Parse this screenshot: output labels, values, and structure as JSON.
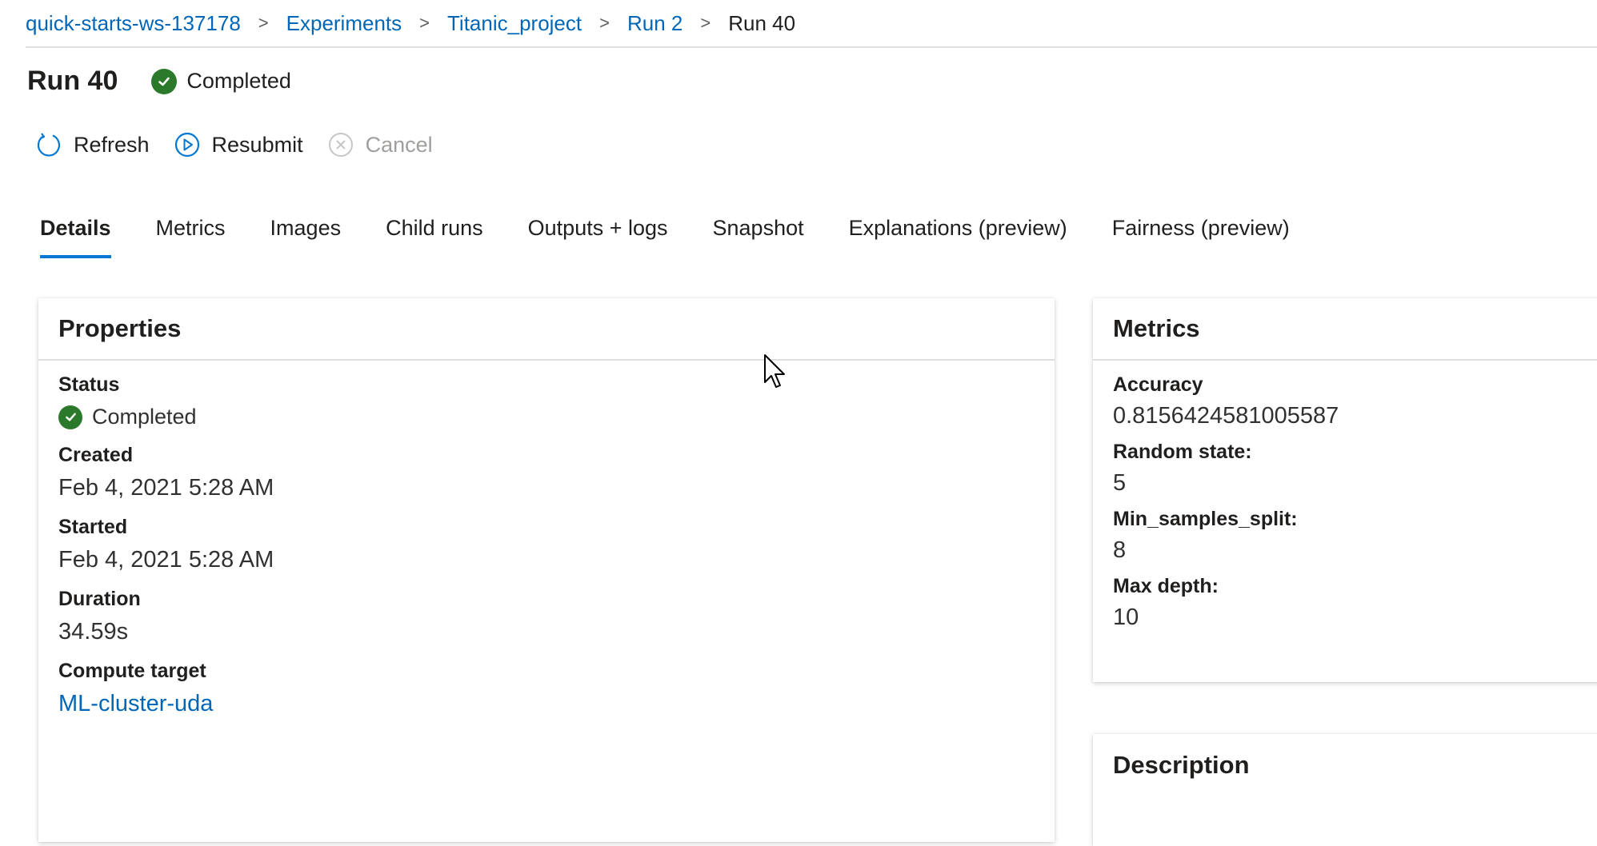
{
  "breadcrumb": {
    "items": [
      "quick-starts-ws-137178",
      "Experiments",
      "Titanic_project",
      "Run 2"
    ],
    "current": "Run 40",
    "separator": ">"
  },
  "header": {
    "title": "Run 40",
    "status": "Completed"
  },
  "toolbar": {
    "refresh": "Refresh",
    "resubmit": "Resubmit",
    "cancel": "Cancel"
  },
  "tabs": [
    "Details",
    "Metrics",
    "Images",
    "Child runs",
    "Outputs + logs",
    "Snapshot",
    "Explanations (preview)",
    "Fairness (preview)"
  ],
  "properties": {
    "title": "Properties",
    "status_label": "Status",
    "status_value": "Completed",
    "created_label": "Created",
    "created_value": "Feb 4, 2021 5:28 AM",
    "started_label": "Started",
    "started_value": "Feb 4, 2021 5:28 AM",
    "duration_label": "Duration",
    "duration_value": "34.59s",
    "compute_label": "Compute target",
    "compute_value": "ML-cluster-uda"
  },
  "metrics": {
    "title": "Metrics",
    "items": [
      {
        "label": "Accuracy",
        "value": "0.8156424581005587"
      },
      {
        "label": "Random state:",
        "value": "5"
      },
      {
        "label": "Min_samples_split:",
        "value": "8"
      },
      {
        "label": "Max depth:",
        "value": "10"
      }
    ]
  },
  "description": {
    "title": "Description"
  },
  "colors": {
    "link": "#0067b8",
    "accent": "#0078d4",
    "success": "#2b7a2b"
  }
}
